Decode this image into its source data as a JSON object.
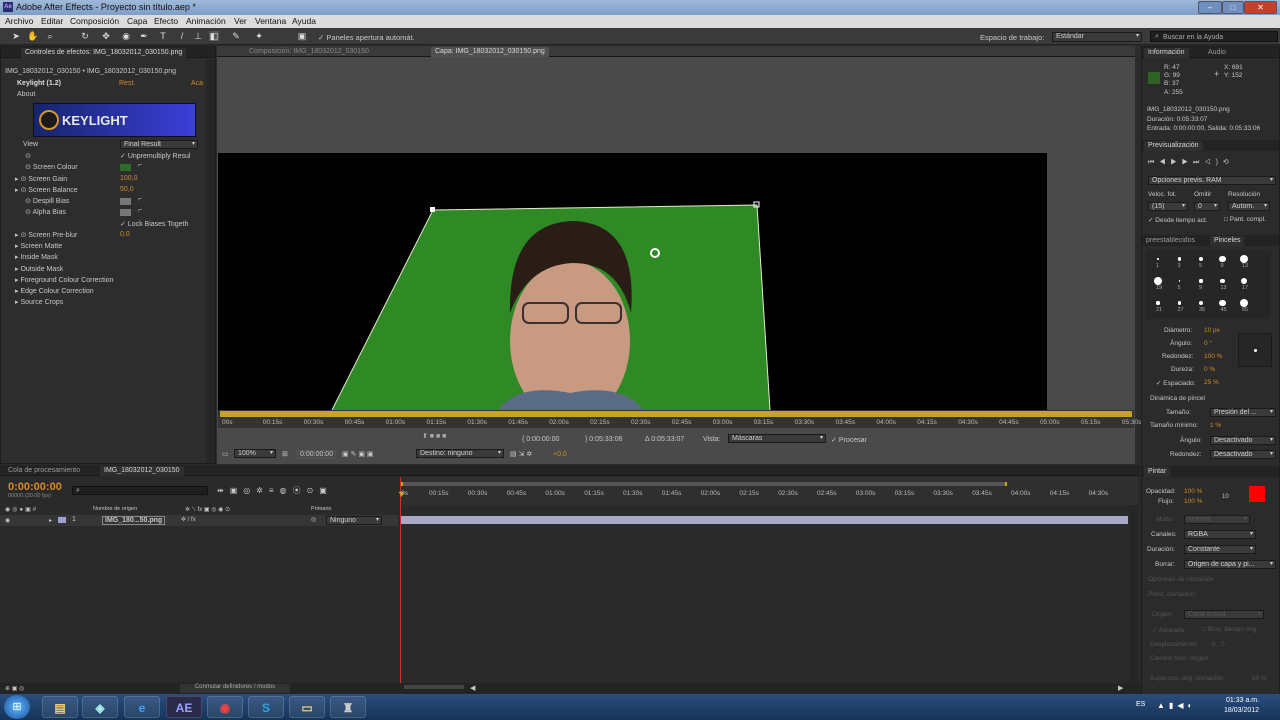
{
  "window": {
    "title": "Adobe After Effects - Proyecto sin título.aep *"
  },
  "menu": [
    "Archivo",
    "Editar",
    "Composición",
    "Capa",
    "Efecto",
    "Animación",
    "Ver",
    "Ventana",
    "Ayuda"
  ],
  "toolbar": {
    "panels_label": "Paneles apertura automát.",
    "workspace_label": "Espacio de trabajo:",
    "workspace_value": "Estándar",
    "help_placeholder": "Buscar en la Ayuda"
  },
  "effects_panel": {
    "tab": "Controles de efectos: IMG_18032012_030150.png",
    "path": "IMG_18032012_030150 • IMG_18032012_030150.png",
    "effect_name": "Keylight (1.2)",
    "reset": "Rest.",
    "about_link": "Aca",
    "about": "About",
    "logo_text": "KEYLIGHT",
    "view_label": "View",
    "view_value": "Final Result",
    "unpremultiply": "Unpremultiply Resul",
    "screen_colour": "Screen Colour",
    "screen_gain": "Screen Gain",
    "screen_gain_value": "100,0",
    "screen_balance": "Screen Balance",
    "screen_balance_value": "50,0",
    "despill_bias": "Despill Bias",
    "alpha_bias": "Alpha Bias",
    "lock_biases": "Lock Biases Togeth",
    "screen_preblur": "Screen Pre-blur",
    "screen_preblur_value": "0,0",
    "groups": [
      "Screen Matte",
      "Inside Mask",
      "Outside Mask",
      "Foreground Colour Correction",
      "Edge Colour Correction",
      "Source Crops"
    ],
    "screen_colour_hex": "#2f6b2a"
  },
  "viewer": {
    "comp_tab": "Composición: IMG_18032012_030150",
    "layer_tab": "Capa: IMG_18032012_030150.png",
    "ruler_ticks": [
      "00s",
      "00:15s",
      "00:30s",
      "00:45s",
      "01:00s",
      "01:15s",
      "01:30s",
      "01:45s",
      "02:00s",
      "02:15s",
      "02:30s",
      "02:45s",
      "03:00s",
      "03:15s",
      "03:30s",
      "03:45s",
      "04:00s",
      "04:15s",
      "04:30s",
      "04:45s",
      "05:00s",
      "05:15s",
      "05:30s"
    ],
    "in_time": "0:00:00:00",
    "out_time": "0:05:33:06",
    "duration": "Δ 0:05:33:07",
    "vista_label": "Vista:",
    "vista_value": "Máscaras",
    "procesar": "Procesar",
    "zoom": "100%",
    "current_time": "0:00:00:00",
    "destino": "Destino: ninguno",
    "exposure": "+0,0",
    "green_hex": "#2f8a26"
  },
  "timeline": {
    "queue_tab": "Cola de procesamiento",
    "comp_tab": "IMG_18032012_030150",
    "time": "0:00:00:00",
    "fps": "00000 (30.00 fps)",
    "col_source": "Nombre de origen",
    "col_parent": "Primario",
    "layer_num": "1",
    "layer_name": "IMG_180...50.png",
    "parent_value": "Ninguno",
    "toggle": "Conmutar definidores / modos",
    "ticks": [
      "0s",
      "00:15s",
      "00:30s",
      "00:45s",
      "01:00s",
      "01:15s",
      "01:30s",
      "01:45s",
      "02:00s",
      "02:15s",
      "02:30s",
      "02:45s",
      "03:00s",
      "03:15s",
      "03:30s",
      "03:45s",
      "04:00s",
      "04:15s",
      "04:30s"
    ]
  },
  "info_panel": {
    "tab": "Información",
    "tab2": "Audio",
    "r": "R: 47",
    "g": "G: 99",
    "b": "B: 37",
    "a": "A: 255",
    "x": "X: 691",
    "y": "Y: 152",
    "file": "IMG_18032012_030150.png",
    "duration": "Duración: 0:05:33:07",
    "inout": "Entrada: 0:00:00:00, Salida: 0:05:33:06",
    "color_hex": "#2f6325"
  },
  "preview_panel": {
    "tab": "Previsualización",
    "options": "Opciones previs. RAM",
    "fps_label": "Veloc. fot.",
    "skip_label": "Omitir",
    "res_label": "Resolución",
    "fps_value": "(15)",
    "skip_value": "0",
    "res_value": "Autom.",
    "from_current": "Desde tiempo act.",
    "fullscreen": "Pant. compl."
  },
  "brushes_panel": {
    "tab": "preestablecidos",
    "tab2": "Pinceles",
    "numbers": [
      "1",
      "3",
      "5",
      "9",
      "13",
      "19",
      "5",
      "9",
      "13",
      "17",
      "21",
      "27",
      "35",
      "45",
      "65"
    ],
    "diameter_label": "Diámetro:",
    "diameter_value": "10 px",
    "angle_label": "Ángulo:",
    "angle_value": "0 °",
    "roundness_label": "Redondez:",
    "roundness_value": "100 %",
    "hardness_label": "Dureza:",
    "hardness_value": "0 %",
    "spacing_label": "Espaciado:",
    "spacing_value": "25 %",
    "dynamics": "Dinámica de pincel",
    "size_label": "Tamaño:",
    "size_value": "Presión del ...",
    "min_size_label": "Tamaño mínimo:",
    "min_size_value": "1 %",
    "angle2_label": "Ángulo:",
    "angle2_value": "Desactivado",
    "roundness2_label": "Redondez:",
    "roundness2_value": "Desactivado"
  },
  "paint_panel": {
    "tab": "Pintar",
    "opacity_label": "Opacidad:",
    "opacity_value": "100 %",
    "flow_label": "Flujo:",
    "flow_value": "100 %",
    "brush_num": "10",
    "mode_label": "Modo:",
    "mode_value": "Normal",
    "channels_label": "Canales:",
    "channels_value": "RGBA",
    "duration_label": "Duración:",
    "duration_value": "Constante",
    "erase_label": "Borrar:",
    "erase_value": "Origen de capa y pi...",
    "clone_options": "Opciones de clonación",
    "clone_preset": "Prest. clonación:",
    "source_label": "Origen:",
    "source_value": "Capa actual",
    "aligned": "Alineado",
    "lock_time": "Bloq. tiempo orig.",
    "offset": "Desplazamiento:",
    "offset_value": "0 , 0",
    "source_time": "Cambio tiem. origen:",
    "overlay": "Superpos. orig. clonación:",
    "overlay_value": "50 %",
    "fg_color": "#ff0000",
    "bg_color": "#ffffff"
  },
  "taskbar": {
    "lang": "ES",
    "time": "01:33 a.m.",
    "date": "18/03/2012",
    "ae_label": "AE"
  }
}
